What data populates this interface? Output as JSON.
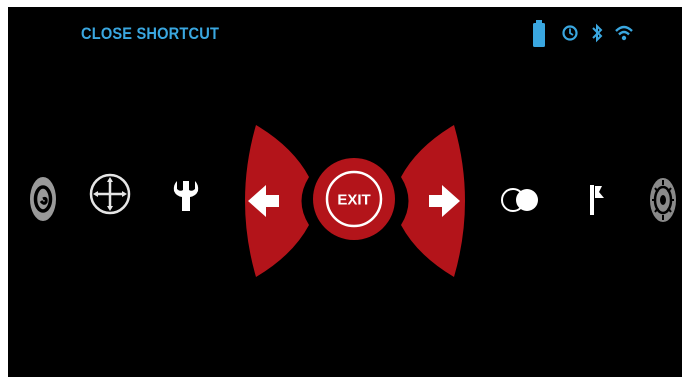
{
  "header": {
    "title": "CLOSE SHORTCUT",
    "accent_color": "#3aa7e0"
  },
  "status_icons": [
    "battery-icon",
    "timer-icon",
    "bluetooth-icon",
    "wifi-icon"
  ],
  "menu": {
    "items": [
      {
        "icon": "spiral-icon",
        "state": "dimmed"
      },
      {
        "icon": "crosshair-icon"
      },
      {
        "icon": "wrench-icon"
      },
      {
        "icon": "left-arrow-icon"
      },
      {
        "icon": "exit-button",
        "label": "EXIT"
      },
      {
        "icon": "right-arrow-icon"
      },
      {
        "icon": "color-mode-icon"
      },
      {
        "icon": "flag-icon"
      },
      {
        "icon": "settings-gear-icon",
        "state": "dimmed"
      }
    ],
    "accent_color": "#b3141a"
  }
}
